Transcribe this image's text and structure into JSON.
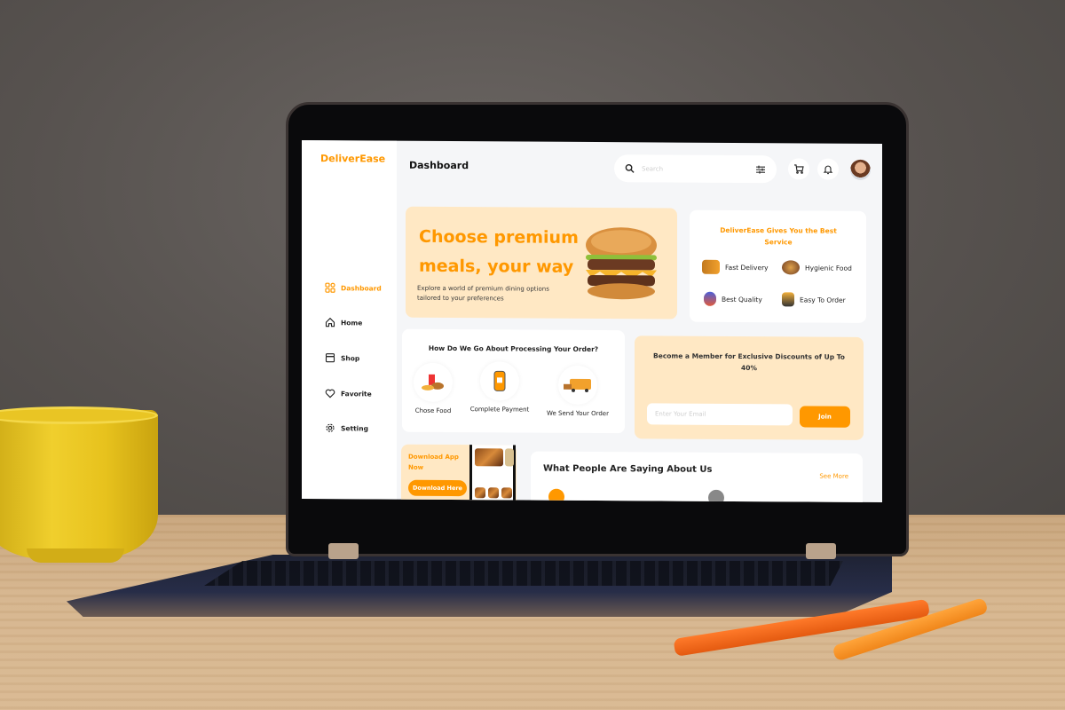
{
  "app": {
    "logo": "DeliverEase",
    "page_title": "Dashboard",
    "brand_color": "#ff9800"
  },
  "header": {
    "search_placeholder": "Search",
    "search_icon": "search-icon",
    "filter_icon": "sliders-icon",
    "cart_icon": "cart-icon",
    "bell_icon": "bell-icon",
    "avatar": "user-avatar"
  },
  "sidebar": {
    "items": [
      {
        "label": "Dashboard",
        "icon": "grid-icon",
        "active": true
      },
      {
        "label": "Home",
        "icon": "home-icon",
        "active": false
      },
      {
        "label": "Shop",
        "icon": "store-icon",
        "active": false
      },
      {
        "label": "Favorite",
        "icon": "heart-icon",
        "active": false
      },
      {
        "label": "Setting",
        "icon": "gear-icon",
        "active": false
      }
    ]
  },
  "hero": {
    "title_line1": "Choose premium",
    "title_line2": "meals, your way",
    "subtitle": "Explore a world of premium dining options tailored to your preferences",
    "image": "burger-image"
  },
  "service": {
    "title": "DeliverEase Gives You the Best Service",
    "features": [
      {
        "label": "Fast Delivery",
        "icon": "truck-icon"
      },
      {
        "label": "Hygienic Food",
        "icon": "burger-icon"
      },
      {
        "label": "Best Quality",
        "icon": "badge-icon"
      },
      {
        "label": "Easy To Order",
        "icon": "courier-icon"
      }
    ]
  },
  "process": {
    "title": "How Do We Go About Processing Your Order?",
    "steps": [
      {
        "label": "Chose Food",
        "icon": "fries-burger-icon"
      },
      {
        "label": "Complete Payment",
        "icon": "phone-payment-icon"
      },
      {
        "label": "We Send Your Order",
        "icon": "delivery-truck-icon"
      }
    ]
  },
  "membership": {
    "title": "Become a Member for Exclusive Discounts of Up To 40%",
    "email_placeholder": "Enter Your Email",
    "join_label": "Join"
  },
  "download": {
    "title": "Download App Now",
    "button_label": "Download Here"
  },
  "reviews": {
    "title": "What People Are Saying About Us",
    "see_more_label": "See More"
  }
}
